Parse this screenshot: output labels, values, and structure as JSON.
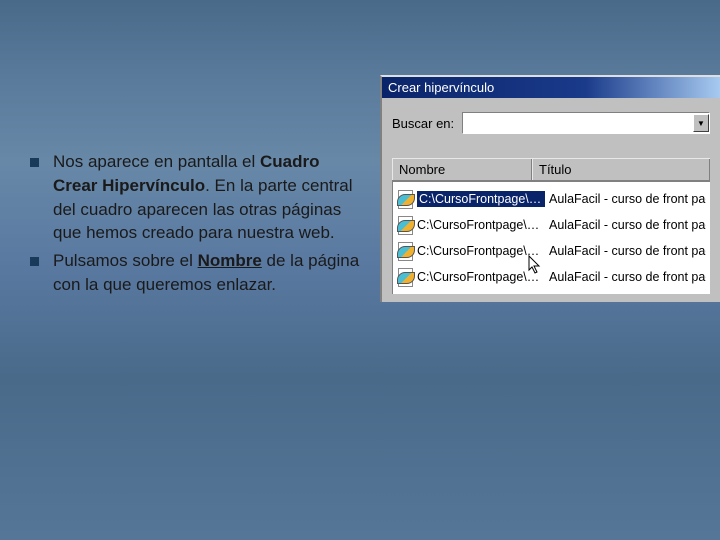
{
  "bullets": [
    {
      "pre": "Nos aparece en pantalla el ",
      "bold": "Cuadro Crear Hipervínculo",
      "post": ". En la parte central del cuadro aparecen las otras páginas que hemos creado para nuestra web."
    },
    {
      "pre": "Pulsamos sobre el ",
      "underline": "Nombre",
      "post": " de la página con la que queremos enlazar."
    }
  ],
  "dialog": {
    "title": "Crear hipervínculo",
    "search_label": "Buscar en:",
    "header_nombre": "Nombre",
    "header_titulo": "Título",
    "rows": [
      {
        "name": "C:\\CursoFrontpage\\Lecc...",
        "title": "AulaFacil - curso de front page gratis online",
        "selected": true
      },
      {
        "name": "C:\\CursoFrontpage\\Lecc...",
        "title": "AulaFacil - curso de front page gratis online",
        "selected": false
      },
      {
        "name": "C:\\CursoFrontpage\\Lecc...",
        "title": "AulaFacil - curso de front page gratis online",
        "selected": false
      },
      {
        "name": "C:\\CursoFrontpage\\Lecc...",
        "title": "AulaFacil - curso de front page gratis online",
        "selected": false
      }
    ]
  }
}
